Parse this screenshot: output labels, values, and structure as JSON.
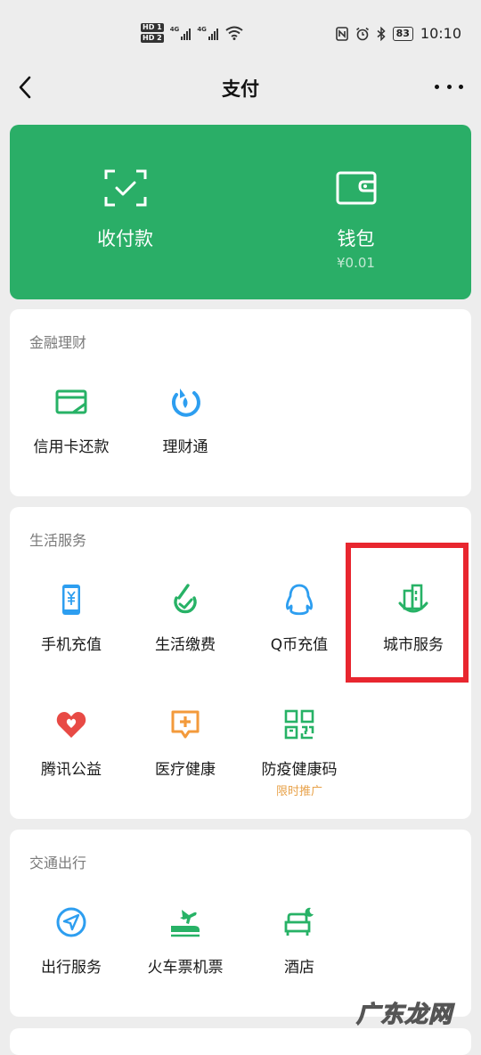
{
  "status_bar": {
    "sim1": "HD 1",
    "sim2": "HD 2",
    "net1": "4G",
    "net2": "4G",
    "battery": "83",
    "time": "10:10"
  },
  "nav": {
    "title": "支付",
    "back_icon": "chevron-left",
    "more_icon": "ellipsis"
  },
  "pay_card": {
    "color": "#2aae67",
    "collect": {
      "label": "收付款",
      "icon": "scan-check"
    },
    "wallet": {
      "label": "钱包",
      "balance": "¥0.01",
      "icon": "wallet"
    }
  },
  "finance": {
    "title": "金融理财",
    "items": [
      {
        "label": "信用卡还款",
        "icon": "credit-card"
      },
      {
        "label": "理财通",
        "icon": "wealth-drop"
      }
    ]
  },
  "life": {
    "title": "生活服务",
    "items": [
      {
        "label": "手机充值",
        "icon": "phone-yuan"
      },
      {
        "label": "生活缴费",
        "icon": "bill-check"
      },
      {
        "label": "Q币充值",
        "icon": "penguin"
      },
      {
        "label": "城市服务",
        "icon": "city-buildings"
      },
      {
        "label": "腾讯公益",
        "icon": "heart"
      },
      {
        "label": "医疗健康",
        "icon": "medical-plus"
      },
      {
        "label": "防疫健康码",
        "icon": "qr-code",
        "tag": "限时推广"
      }
    ],
    "highlight_color": "#e8262f"
  },
  "transport": {
    "title": "交通出行",
    "items": [
      {
        "label": "出行服务",
        "icon": "navigation-arrow"
      },
      {
        "label": "火车票机票",
        "icon": "train-plane"
      },
      {
        "label": "酒店",
        "icon": "hotel-bed"
      }
    ]
  },
  "watermark": "广东龙网"
}
